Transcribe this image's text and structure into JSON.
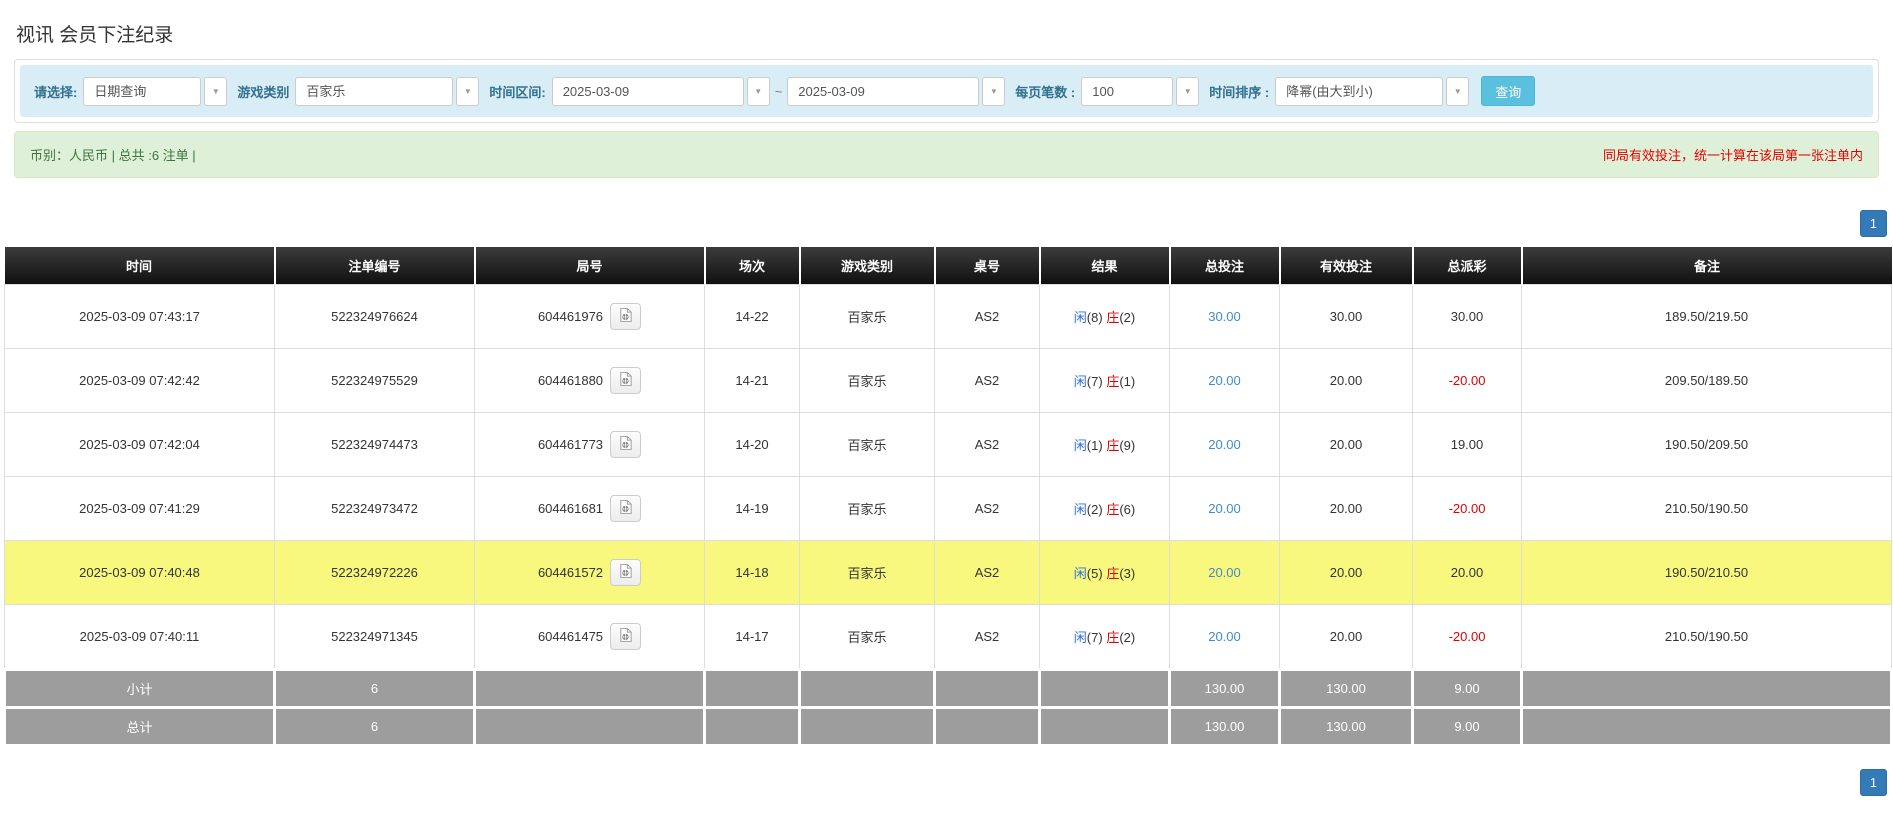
{
  "page": {
    "title": "视讯 会员下注纪录"
  },
  "filters": {
    "select_label": "请选择:",
    "select_value": "日期查询",
    "game_label": "游戏类别",
    "game_value": "百家乐",
    "range_label": "时间区间:",
    "date_from": "2025-03-09",
    "tilde": "~",
    "date_to": "2025-03-09",
    "per_page_label": "每页笔数 :",
    "per_page_value": "100",
    "sort_label": "时间排序 :",
    "sort_value": "降幂(由大到小)",
    "search_button": "查询",
    "caret": "▼"
  },
  "info_bar": {
    "left": "币别：人民币 | 总共 :6 注单 |",
    "right": "同局有效投注，统一计算在该局第一张注单内"
  },
  "pagination": {
    "page": "1"
  },
  "table": {
    "headers": [
      "时间",
      "注单编号",
      "局号",
      "场次",
      "游戏类别",
      "桌号",
      "结果",
      "总投注",
      "有效投注",
      "总派彩",
      "备注"
    ],
    "rows": [
      {
        "time": "2025-03-09 07:43:17",
        "bet_id": "522324976624",
        "round_id": "604461976",
        "session": "14-22",
        "game": "百家乐",
        "table_no": "AS2",
        "result": {
          "player_label": "闲",
          "player_val": "(8)",
          "banker_label": "庄",
          "banker_val": "(2)"
        },
        "total_bet": "30.00",
        "valid_bet": "30.00",
        "payout": "30.00",
        "remark": "189.50/219.50",
        "highlight": false
      },
      {
        "time": "2025-03-09 07:42:42",
        "bet_id": "522324975529",
        "round_id": "604461880",
        "session": "14-21",
        "game": "百家乐",
        "table_no": "AS2",
        "result": {
          "player_label": "闲",
          "player_val": "(7)",
          "banker_label": "庄",
          "banker_val": "(1)"
        },
        "total_bet": "20.00",
        "valid_bet": "20.00",
        "payout": "-20.00",
        "remark": "209.50/189.50",
        "highlight": false
      },
      {
        "time": "2025-03-09 07:42:04",
        "bet_id": "522324974473",
        "round_id": "604461773",
        "session": "14-20",
        "game": "百家乐",
        "table_no": "AS2",
        "result": {
          "player_label": "闲",
          "player_val": "(1)",
          "banker_label": "庄",
          "banker_val": "(9)"
        },
        "total_bet": "20.00",
        "valid_bet": "20.00",
        "payout": "19.00",
        "remark": "190.50/209.50",
        "highlight": false
      },
      {
        "time": "2025-03-09 07:41:29",
        "bet_id": "522324973472",
        "round_id": "604461681",
        "session": "14-19",
        "game": "百家乐",
        "table_no": "AS2",
        "result": {
          "player_label": "闲",
          "player_val": "(2)",
          "banker_label": "庄",
          "banker_val": "(6)"
        },
        "total_bet": "20.00",
        "valid_bet": "20.00",
        "payout": "-20.00",
        "remark": "210.50/190.50",
        "highlight": false
      },
      {
        "time": "2025-03-09 07:40:48",
        "bet_id": "522324972226",
        "round_id": "604461572",
        "session": "14-18",
        "game": "百家乐",
        "table_no": "AS2",
        "result": {
          "player_label": "闲",
          "player_val": "(5)",
          "banker_label": "庄",
          "banker_val": "(3)"
        },
        "total_bet": "20.00",
        "valid_bet": "20.00",
        "payout": "20.00",
        "remark": "190.50/210.50",
        "highlight": true
      },
      {
        "time": "2025-03-09 07:40:11",
        "bet_id": "522324971345",
        "round_id": "604461475",
        "session": "14-17",
        "game": "百家乐",
        "table_no": "AS2",
        "result": {
          "player_label": "闲",
          "player_val": "(7)",
          "banker_label": "庄",
          "banker_val": "(2)"
        },
        "total_bet": "20.00",
        "valid_bet": "20.00",
        "payout": "-20.00",
        "remark": "210.50/190.50",
        "highlight": false
      }
    ],
    "subtotal": {
      "label": "小计",
      "count": "6",
      "total_bet": "130.00",
      "valid_bet": "130.00",
      "payout": "9.00"
    },
    "total": {
      "label": "总计",
      "count": "6",
      "total_bet": "130.00",
      "valid_bet": "130.00",
      "payout": "9.00"
    }
  },
  "colors": {
    "accent_blue": "#337ab7",
    "filter_bar": "#d9edf7",
    "info_green": "#dff0d8",
    "highlight_yellow": "#f8f87e",
    "negative_red": "#e60000",
    "player_blue": "#2a6fdb"
  }
}
